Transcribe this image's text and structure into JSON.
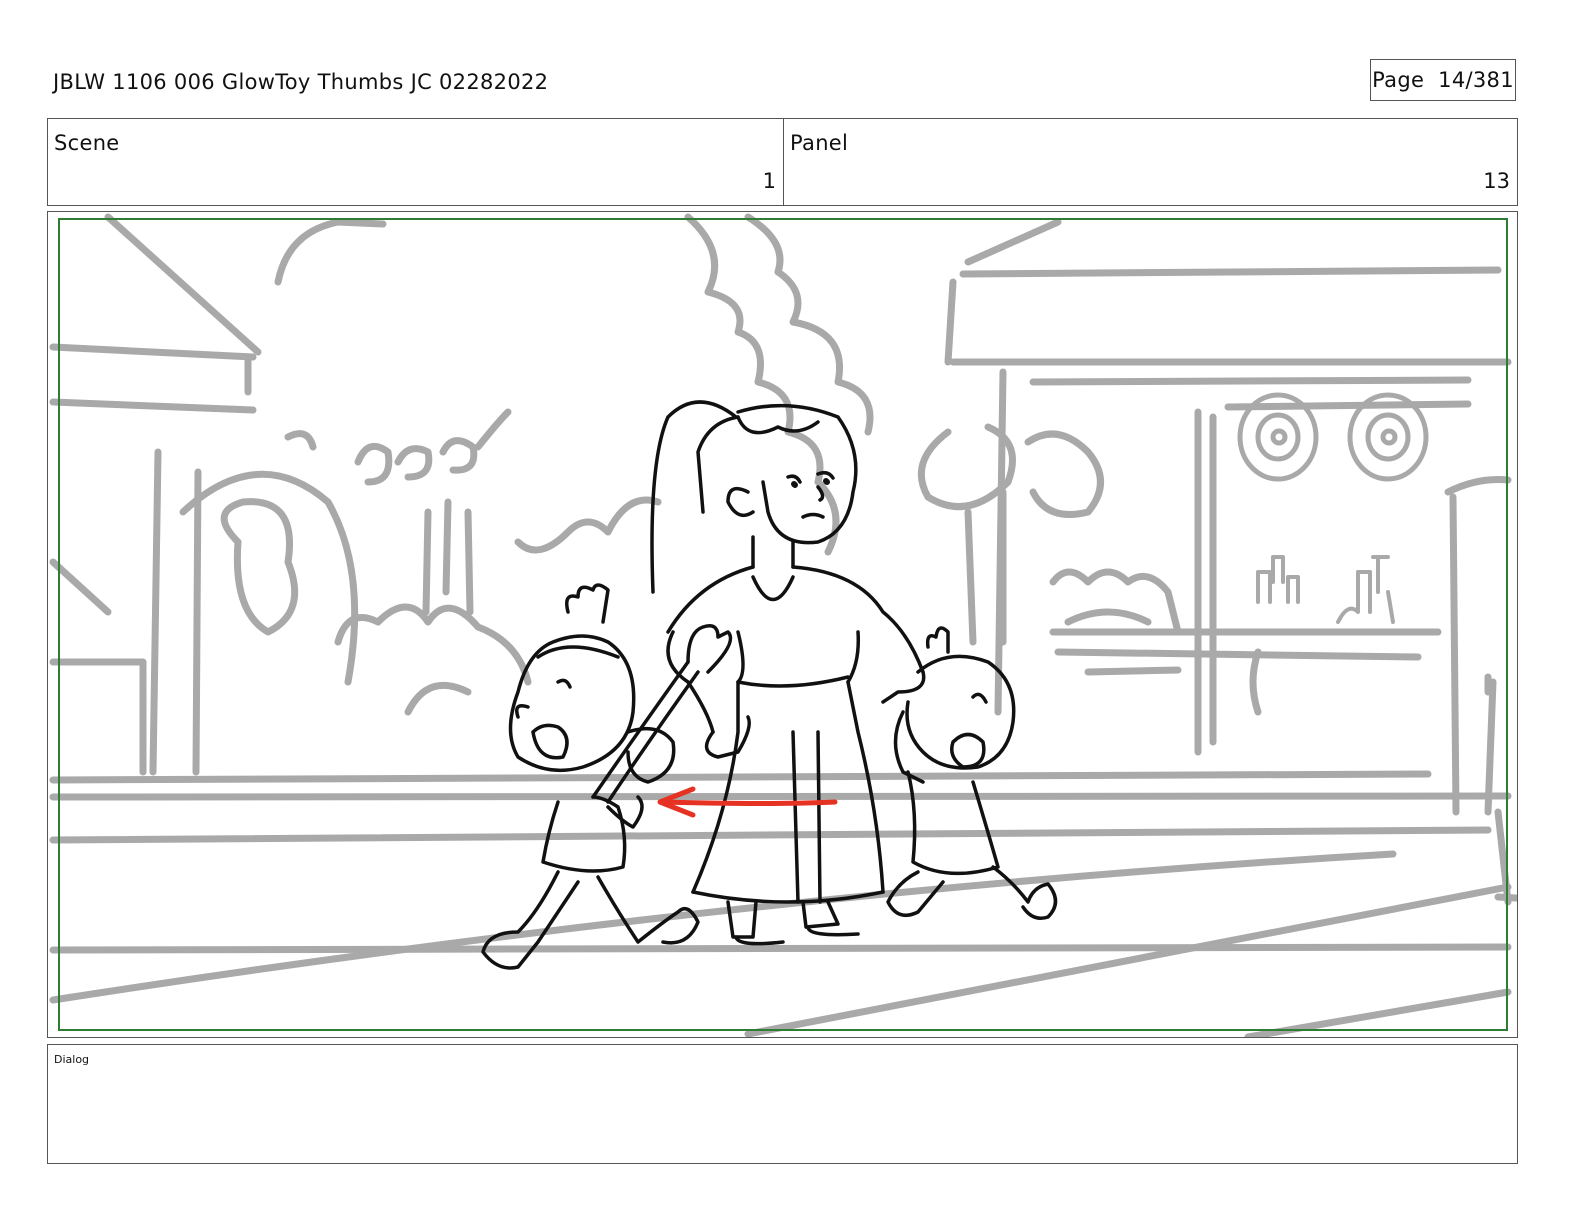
{
  "document": {
    "title": "JBLW 1106 006 GlowToy Thumbs JC 02282022",
    "page_label": "Page",
    "page_value": "14/381"
  },
  "info": {
    "scene_label": "Scene",
    "scene_value": "1",
    "panel_label": "Panel",
    "panel_value": "13"
  },
  "frame": {
    "safe_area_color": "#2e7d32",
    "background_line_color": "#a9a9a9",
    "character_line_color": "#111111",
    "motion_arrow_color": "#e53222"
  },
  "dialog": {
    "label": "Dialog",
    "text": ""
  }
}
